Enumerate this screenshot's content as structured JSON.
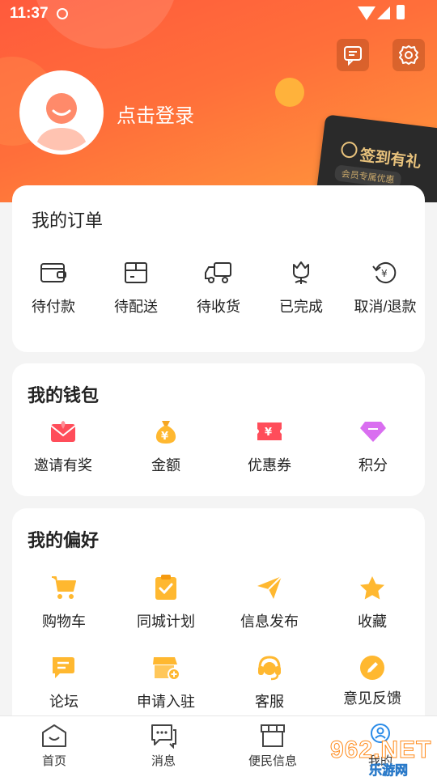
{
  "status_bar": {
    "time": "11:37"
  },
  "header": {
    "login_text": "点击登录",
    "message_icon": "message-icon",
    "settings_icon": "gear-icon",
    "signin_card": {
      "title": "签到有礼",
      "subtitle": "会员专属优惠"
    },
    "colors": {
      "gradient_start": "#ff5a3c",
      "gradient_end": "#ff9a3c"
    }
  },
  "orders": {
    "title": "我的订单",
    "items": [
      {
        "label": "待付款",
        "icon": "wallet-icon"
      },
      {
        "label": "待配送",
        "icon": "package-icon"
      },
      {
        "label": "待收货",
        "icon": "truck-icon"
      },
      {
        "label": "已完成",
        "icon": "flower-icon"
      },
      {
        "label": "取消/退款",
        "icon": "refund-icon"
      }
    ]
  },
  "wallet": {
    "title": "我的钱包",
    "items": [
      {
        "label": "邀请有奖",
        "icon": "invite-envelope-icon"
      },
      {
        "label": "金额",
        "icon": "money-bag-icon"
      },
      {
        "label": "优惠券",
        "icon": "coupon-icon"
      },
      {
        "label": "积分",
        "icon": "diamond-icon"
      }
    ]
  },
  "preferences": {
    "title": "我的偏好",
    "items": [
      {
        "label": "购物车",
        "icon": "cart-icon"
      },
      {
        "label": "同城计划",
        "icon": "clipboard-check-icon"
      },
      {
        "label": "信息发布",
        "icon": "paper-plane-icon"
      },
      {
        "label": "收藏",
        "icon": "star-icon"
      },
      {
        "label": "论坛",
        "icon": "forum-icon"
      },
      {
        "label": "申请入驻",
        "icon": "store-add-icon"
      },
      {
        "label": "客服",
        "icon": "headset-icon"
      },
      {
        "label": "意见反馈",
        "icon": "edit-icon"
      }
    ]
  },
  "bottom_nav": {
    "items": [
      {
        "label": "首页",
        "icon": "home-icon"
      },
      {
        "label": "消息",
        "icon": "chat-icon"
      },
      {
        "label": "便民信息",
        "icon": "shop-icon"
      },
      {
        "label": "我的",
        "icon": "user-icon"
      }
    ]
  },
  "watermark": {
    "number": "962.NET",
    "text": "乐游网"
  }
}
